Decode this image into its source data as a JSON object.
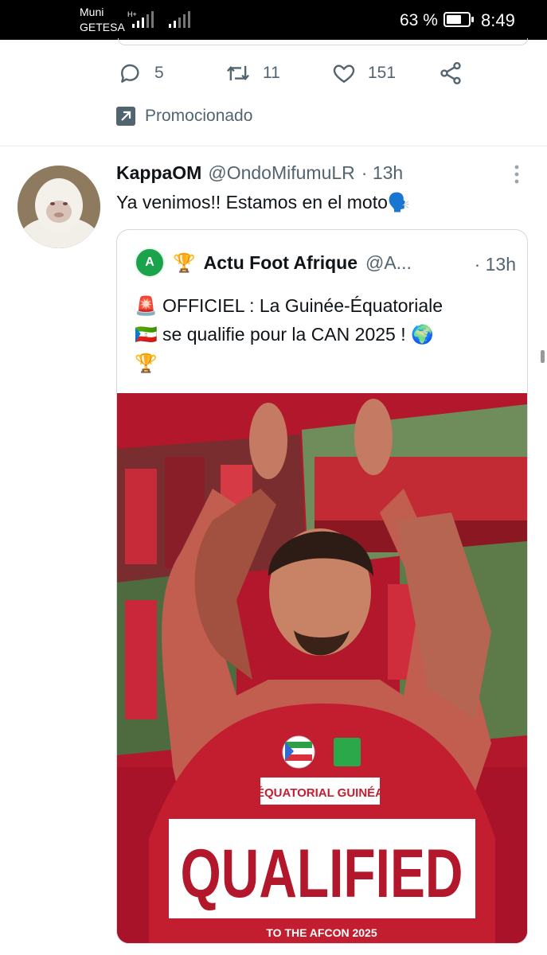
{
  "status_bar": {
    "carrier_line1": "Muni",
    "carrier_line2": "GETESA",
    "network": "H+",
    "battery": "63 %",
    "battery_level": 0.63,
    "time": "8:49"
  },
  "prev_tweet": {
    "replies": "5",
    "retweets": "11",
    "likes": "151",
    "promoted_label": "Promocionado"
  },
  "tweet": {
    "name": "KappaOM",
    "handle": "@OndoMifumuLR",
    "time": "· 13h",
    "text": "Ya venimos!! Estamos en el moto🗣️",
    "quote": {
      "name": "Actu Foot Afrique",
      "handle": "@A...",
      "time": "· 13h",
      "text_line1": "🚨 OFFICIEL : La Guinée-Équatoriale",
      "text_line2": "🇬🇶 se qualifie pour la CAN 2025 ! 🌍",
      "text_line3": "🏆",
      "image": {
        "country": "ÉQUATORIAL GUINÉA",
        "headline": "QUALIFIED",
        "subline": "TO THE AFCON 2025"
      }
    }
  },
  "colors": {
    "text": "#0f1419",
    "secondary": "#536471",
    "border": "#cfd9de",
    "poster_red": "#b3172b"
  }
}
